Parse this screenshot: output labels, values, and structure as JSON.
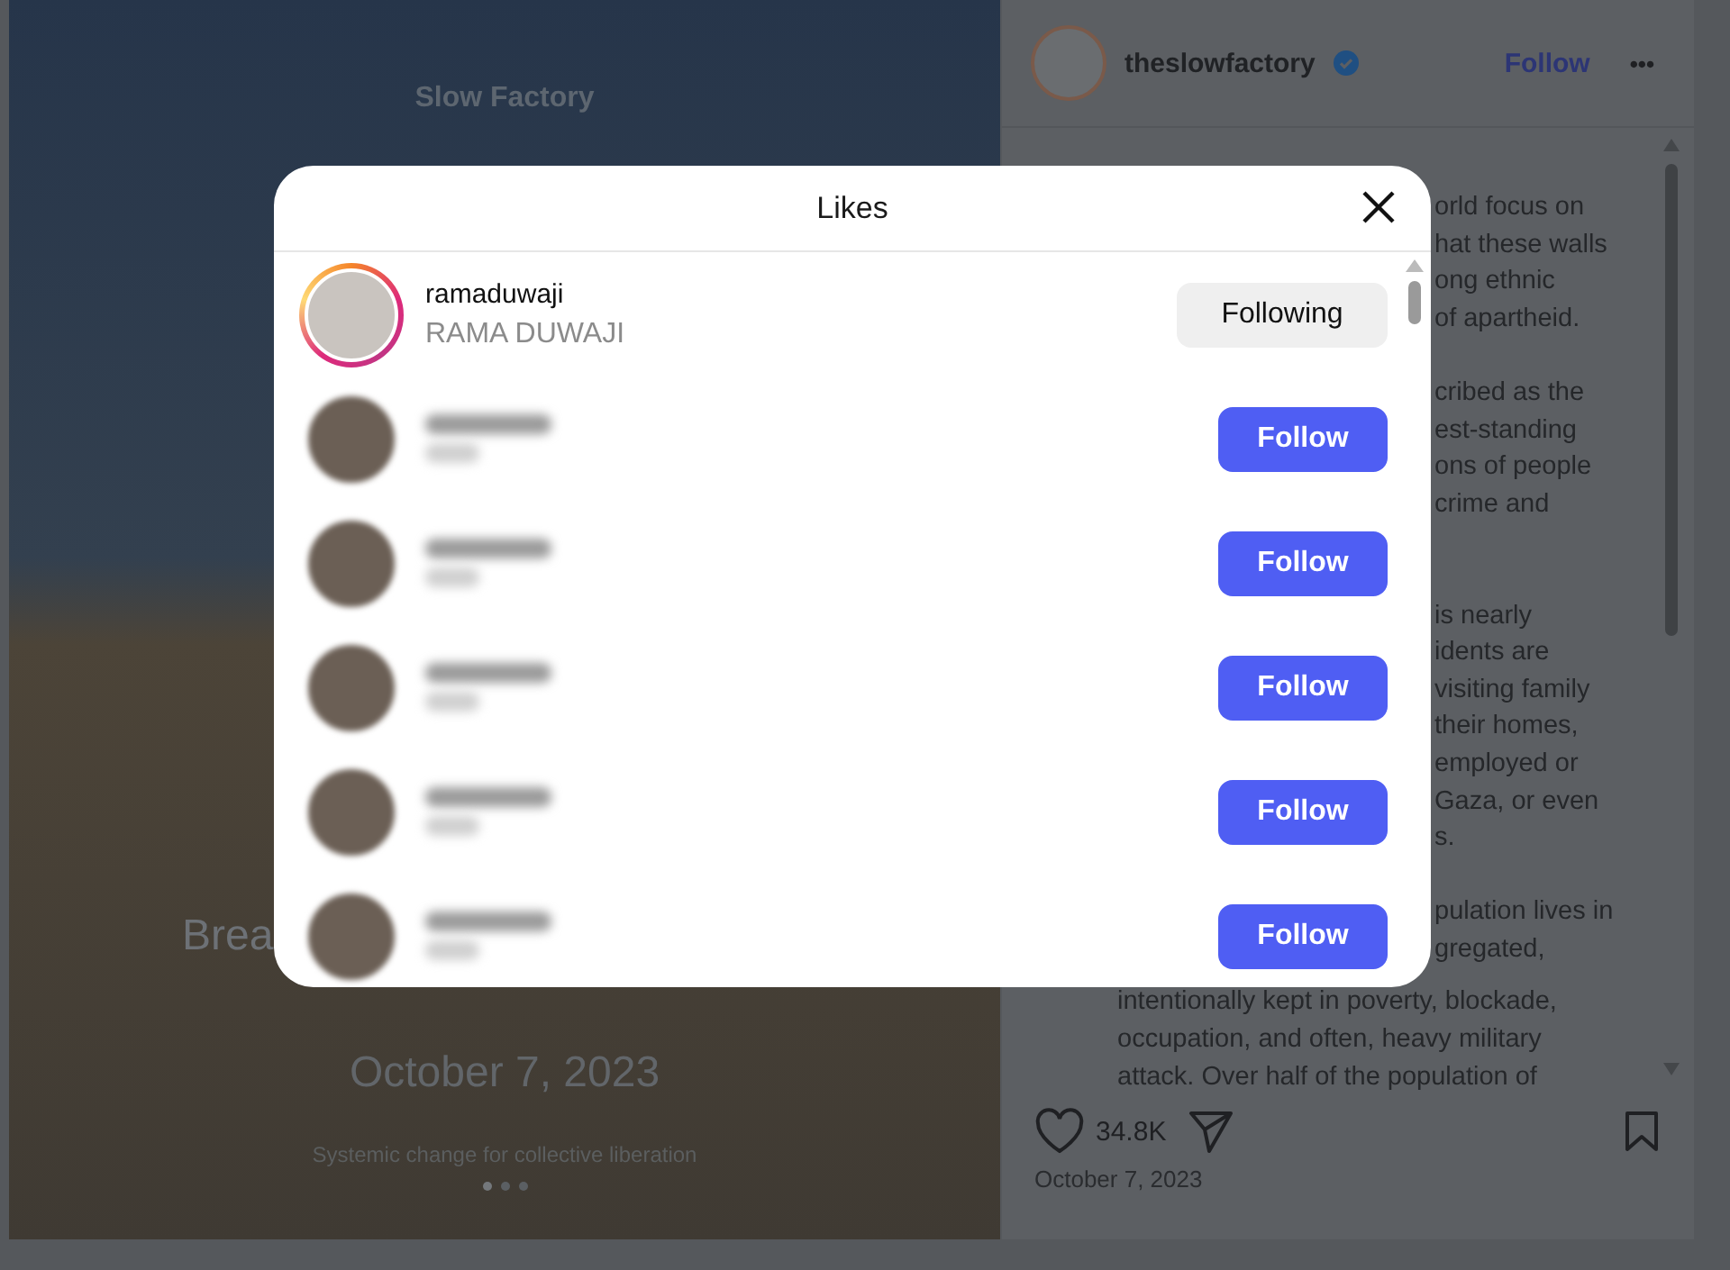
{
  "post_image": {
    "brand": "Slow Factory",
    "headline_fragment": "Brea",
    "date": "October 7, 2023",
    "tagline": "Systemic change for collective liberation"
  },
  "post": {
    "account": "theslowfactory",
    "verified": true,
    "follow_label": "Follow",
    "more_label": "•••",
    "caption_partial": [
      [
        "orld focus on",
        "hat these walls",
        "ong ethnic",
        "of apartheid."
      ],
      [
        "cribed as the",
        "est-standing",
        "ons of people",
        "crime and"
      ],
      [
        "is nearly",
        "idents are",
        "visiting family",
        "their homes,",
        "employed or",
        "Gaza, or even",
        "s."
      ],
      [
        "pulation lives in",
        "gregated,"
      ]
    ],
    "caption_full": [
      "intentionally kept in poverty, blockade,",
      "occupation, and often, heavy military",
      "attack. Over half of the population of"
    ],
    "likes": "34.8K",
    "date": "October 7, 2023"
  },
  "likes_dialog": {
    "title": "Likes",
    "users": [
      {
        "username": "ramaduwaji",
        "full_name": "RAMA DUWAJI",
        "story_ring": true,
        "blurred": false,
        "button": "Following",
        "following": true
      },
      {
        "blurred": true,
        "story_ring": false,
        "button": "Follow",
        "following": false
      },
      {
        "blurred": true,
        "story_ring": false,
        "button": "Follow",
        "following": false
      },
      {
        "blurred": true,
        "story_ring": false,
        "button": "Follow",
        "following": false
      },
      {
        "blurred": true,
        "story_ring": false,
        "button": "Follow",
        "following": false
      },
      {
        "blurred": true,
        "story_ring": false,
        "button": "Follow",
        "following": false
      }
    ]
  }
}
